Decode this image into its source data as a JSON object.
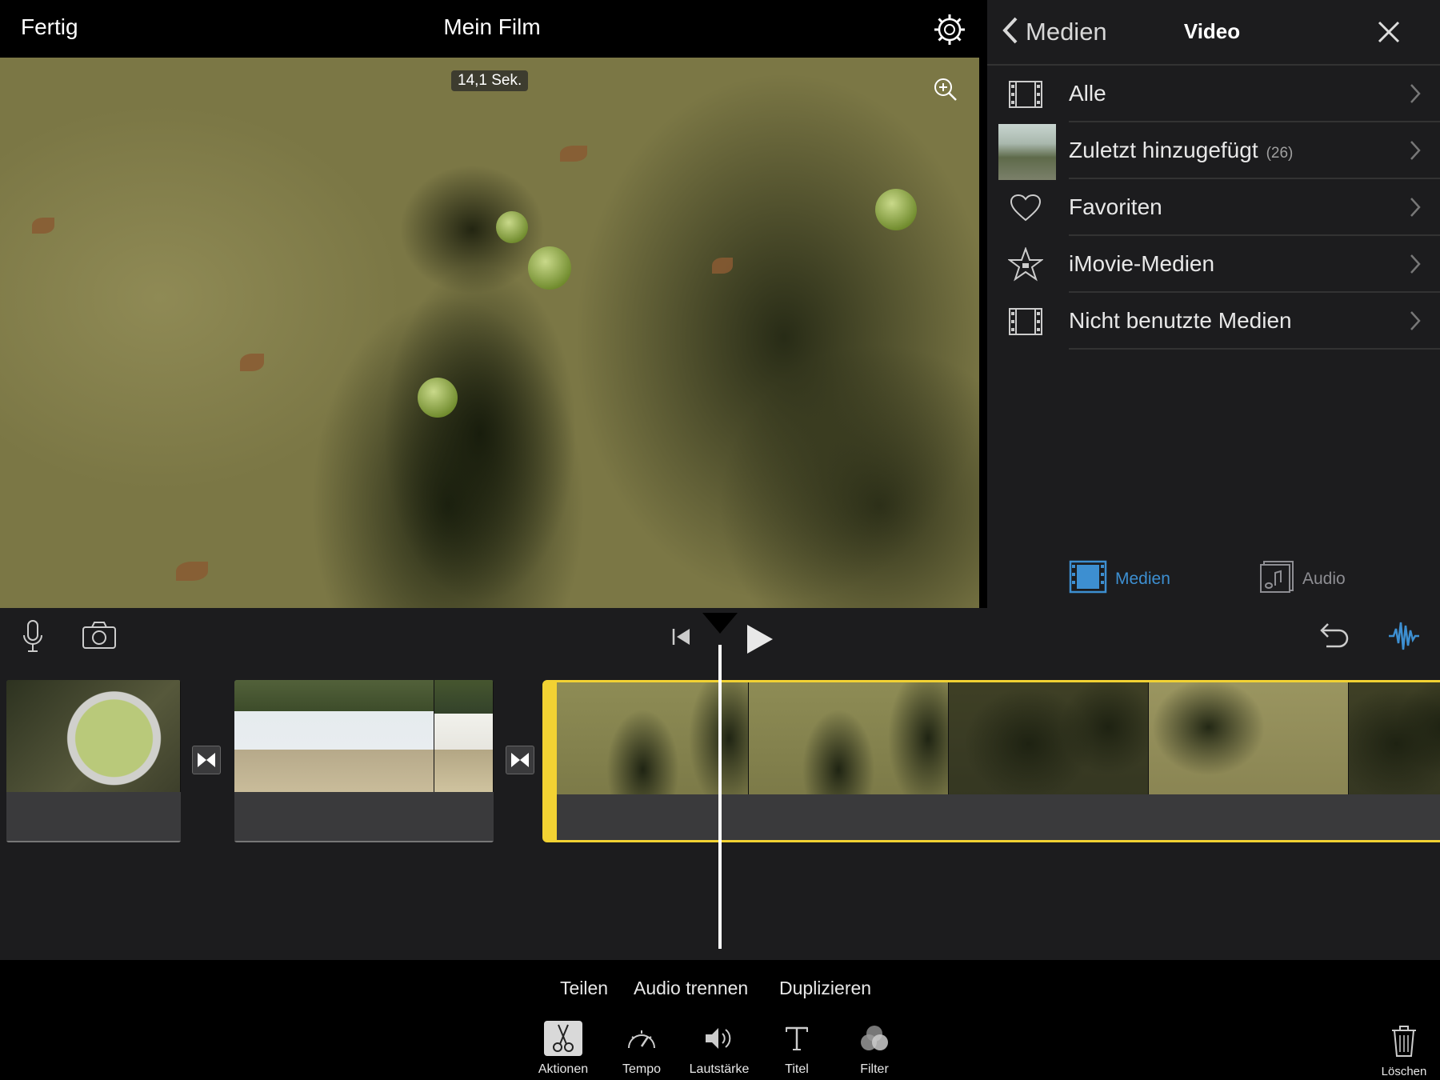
{
  "header": {
    "done_label": "Fertig",
    "title": "Mein Film",
    "settings_icon": "gear-icon"
  },
  "viewer": {
    "duration": "14,1 Sek.",
    "zoom_icon": "zoom-in-icon"
  },
  "media_panel": {
    "back_label": "Medien",
    "title": "Video",
    "close_icon": "close-icon",
    "items": [
      {
        "label": "Alle",
        "icon": "film-strip-icon"
      },
      {
        "label": "Zuletzt hinzugefügt",
        "count": "(26)",
        "icon": "thumbnail"
      },
      {
        "label": "Favoriten",
        "icon": "heart-icon"
      },
      {
        "label": "iMovie-Medien",
        "icon": "star-icon"
      },
      {
        "label": "Nicht benutzte Medien",
        "icon": "film-strip-icon"
      }
    ],
    "segments": [
      {
        "label": "Medien",
        "active": true,
        "color": "#3d8fd1"
      },
      {
        "label": "Audio",
        "active": false,
        "color": "#8e8e93"
      }
    ]
  },
  "timeline_toolbar": {
    "icons": [
      "microphone-icon",
      "camera-icon",
      "skip-back-icon",
      "play-icon",
      "undo-icon",
      "waveform-icon"
    ]
  },
  "clip_actions": [
    "Teilen",
    "Audio trennen",
    "Duplizieren"
  ],
  "tools": [
    {
      "label": "Aktionen",
      "icon": "scissors-icon",
      "active": true
    },
    {
      "label": "Tempo",
      "icon": "speedometer-icon"
    },
    {
      "label": "Lautstärke",
      "icon": "speaker-icon"
    },
    {
      "label": "Titel",
      "icon": "title-icon"
    },
    {
      "label": "Filter",
      "icon": "filter-icon"
    }
  ],
  "delete_label": "Löschen",
  "colors": {
    "accent_blue": "#3d8fd1",
    "selection_yellow": "#f2d233",
    "panel_bg": "#1c1c1e"
  }
}
